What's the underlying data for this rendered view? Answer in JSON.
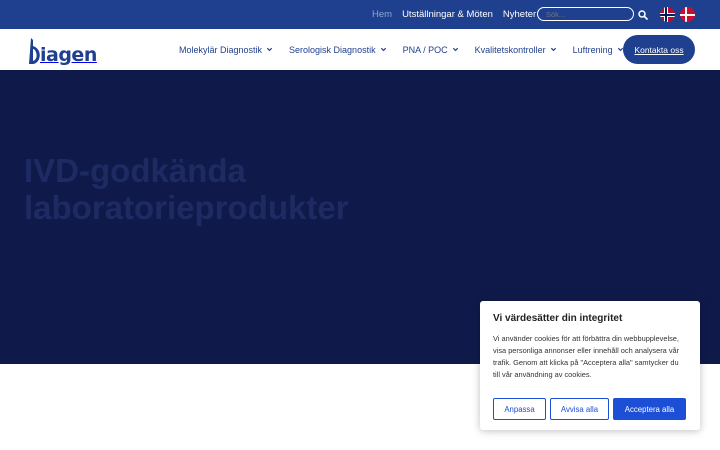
{
  "top_bar": {
    "nav": [
      {
        "label": "Hem",
        "active": true
      },
      {
        "label": "Utställningar & Möten",
        "active": false
      },
      {
        "label": "Nyheter",
        "active": false
      }
    ],
    "search": {
      "placeholder": "Sök..."
    },
    "languages": [
      "Norsk",
      "Dansk"
    ]
  },
  "header": {
    "logo_text": "iagen",
    "main_nav": [
      {
        "label": "Molekylär Diagnostik"
      },
      {
        "label": "Serologisk Diagnostik"
      },
      {
        "label": "PNA / POC"
      },
      {
        "label": "Kvalitetskontroller"
      },
      {
        "label": "Luftrening"
      }
    ],
    "contact_button": "Kontakta oss"
  },
  "hero": {
    "title": "IVD-godkända laboratorieprodukter"
  },
  "cookie_banner": {
    "title": "Vi värdesätter din integritet",
    "body": "Vi använder cookies för att förbättra din webbupplevelse, visa personliga annonser eller innehåll och analysera vår trafik. Genom att klicka på \"Acceptera alla\" samtycker du till vår användning av cookies.",
    "buttons": {
      "customize": "Anpassa",
      "reject": "Avvisa alla",
      "accept": "Acceptera alla"
    }
  },
  "colors": {
    "brand_blue": "#1f3f8f",
    "hero_navy": "#0f1a4a",
    "button_blue": "#1c4fd6"
  }
}
